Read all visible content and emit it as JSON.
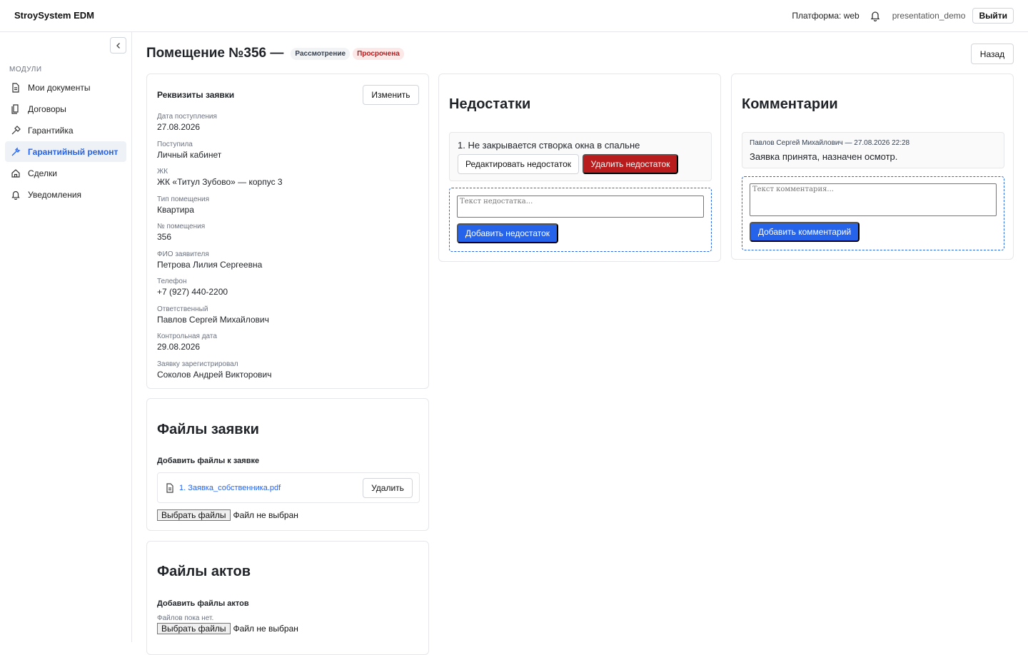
{
  "app": {
    "brand": "StroySystem EDM",
    "platform": "Платформа: web",
    "user": "presentation_demo",
    "logout_label": "Выйти"
  },
  "sidebar": {
    "section_label": "МОДУЛИ",
    "items": [
      {
        "label": "Мои документы",
        "icon": "document-icon"
      },
      {
        "label": "Договоры",
        "icon": "contracts-icon"
      },
      {
        "label": "Гарантийка",
        "icon": "hammer-icon"
      },
      {
        "label": "Гарантийный ремонт",
        "icon": "wrench-icon",
        "active": true
      },
      {
        "label": "Сделки",
        "icon": "home-icon"
      },
      {
        "label": "Уведомления",
        "icon": "bell-icon"
      }
    ]
  },
  "header": {
    "title": "Помещение №356 —",
    "status_badge": "Рассмотрение",
    "overdue_badge": "Просрочена",
    "back_label": "Назад"
  },
  "props": {
    "title": "Реквизиты заявки",
    "edit_label": "Изменить",
    "fields": [
      {
        "label": "Дата поступления",
        "value": "27.08.2026"
      },
      {
        "label": "Поступила",
        "value": "Личный кабинет"
      },
      {
        "label": "ЖК",
        "value": "ЖК «Титул Зубово» — корпус 3"
      },
      {
        "label": "Тип помещения",
        "value": "Квартира"
      },
      {
        "label": "№ помещения",
        "value": "356"
      },
      {
        "label": "ФИО заявителя",
        "value": "Петрова Лилия Сергеевна"
      },
      {
        "label": "Телефон",
        "value": "+7 (927) 440-2200"
      },
      {
        "label": "Ответственный",
        "value": "Павлов Сергей Михайлович"
      },
      {
        "label": "Контрольная дата",
        "value": "29.08.2026"
      },
      {
        "label": "Заявку зарегистрировал",
        "value": "Соколов Андрей Викторович"
      }
    ]
  },
  "request_files": {
    "title": "Файлы заявки",
    "subtitle": "Добавить файлы к заявке",
    "files": [
      {
        "name": "1. Заявка_собственника.pdf"
      }
    ],
    "delete_label": "Удалить",
    "choose_label": "Выбрать файлы",
    "no_file_label": "Файл не выбран"
  },
  "act_files": {
    "title": "Файлы актов",
    "subtitle": "Добавить файлы актов",
    "empty_note": "Файлов пока нет.",
    "choose_label": "Выбрать файлы",
    "no_file_label": "Файл не выбран"
  },
  "defects": {
    "title": "Недостатки",
    "items": [
      {
        "text": "1. Не закрывается створка окна в спальне"
      }
    ],
    "edit_label": "Редактировать недостаток",
    "delete_label": "Удалить недостаток",
    "placeholder": "Текст недостатка...",
    "add_label": "Добавить недостаток"
  },
  "comments": {
    "title": "Комментарии",
    "items": [
      {
        "meta": "Павлов Сергей Михайлович — 27.08.2026 22:28",
        "text": "Заявка принята, назначен осмотр."
      }
    ],
    "placeholder": "Текст комментария...",
    "add_label": "Добавить комментарий"
  },
  "colors": {
    "accent": "#2563eb",
    "danger": "#b91c1c",
    "overdue_bg": "#fde8e8"
  }
}
